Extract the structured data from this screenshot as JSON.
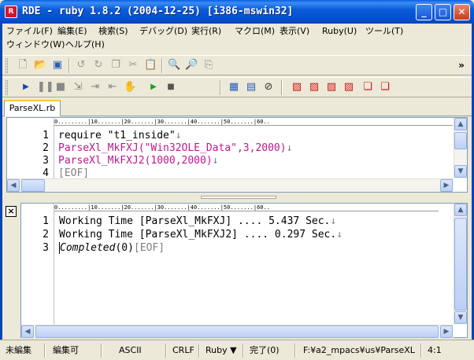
{
  "window": {
    "title": "RDE - ruby 1.8.2 (2004-12-25) [i386-mswin32]",
    "icon_label": "R",
    "controls": {
      "minimize": "_",
      "maximize": "□",
      "close": "✕"
    }
  },
  "menu": [
    "ファイル(F)",
    "編集(E)",
    "検索(S)",
    "デバッグ(D)",
    "実行(R)",
    "マクロ(M)",
    "表示(V)",
    "Ruby(U)",
    "ツール(T)",
    "ウィンドウ(W)",
    "ヘルプ(H)"
  ],
  "toolbar_overflow": "»",
  "tab": {
    "label": "ParseXL.rb"
  },
  "ruler_text": "0.........|10.......|20.......|30.......|40.......|50.......|60..",
  "editor": {
    "lines": [
      {
        "num": "1",
        "parts": [
          {
            "text": "require \"t1_inside\"",
            "color": "black"
          },
          {
            "text": "↓",
            "color": "gray"
          }
        ]
      },
      {
        "num": "2",
        "parts": [
          {
            "text": "ParseXl_MkFXJ(\"Win32OLE_Data\",3,2000)",
            "color": "pink"
          },
          {
            "text": "↓",
            "color": "gray"
          }
        ]
      },
      {
        "num": "3",
        "parts": [
          {
            "text": "ParseXl_MkFXJ2(1000,2000)",
            "color": "pink"
          },
          {
            "text": "↓",
            "color": "gray"
          }
        ]
      },
      {
        "num": "4",
        "parts": [
          {
            "text": "[EOF]",
            "color": "gray"
          }
        ]
      }
    ]
  },
  "output": {
    "close_label": "×",
    "lines": [
      {
        "num": "1",
        "text": "Working Time [ParseXl_MkFXJ] .... 5.437 Sec.",
        "eol": "↓"
      },
      {
        "num": "2",
        "text": "Working Time [ParseXl_MkFXJ2] .... 0.297 Sec.",
        "eol": "↓"
      },
      {
        "num": "3",
        "text": "Completed",
        "suffix": "(0)",
        "eof": "[EOF]"
      }
    ]
  },
  "status": {
    "edit_state": "未編集",
    "editable": "編集可",
    "encoding": "ASCII",
    "newline": "CRLF",
    "language": "Ruby ▼",
    "result": "完了(0)",
    "path": "F:¥a2_mpacs¥us¥ParseXL",
    "position": "4:1"
  },
  "colors": {
    "pink": "#c0168c",
    "titlebar": "#0550d0"
  }
}
